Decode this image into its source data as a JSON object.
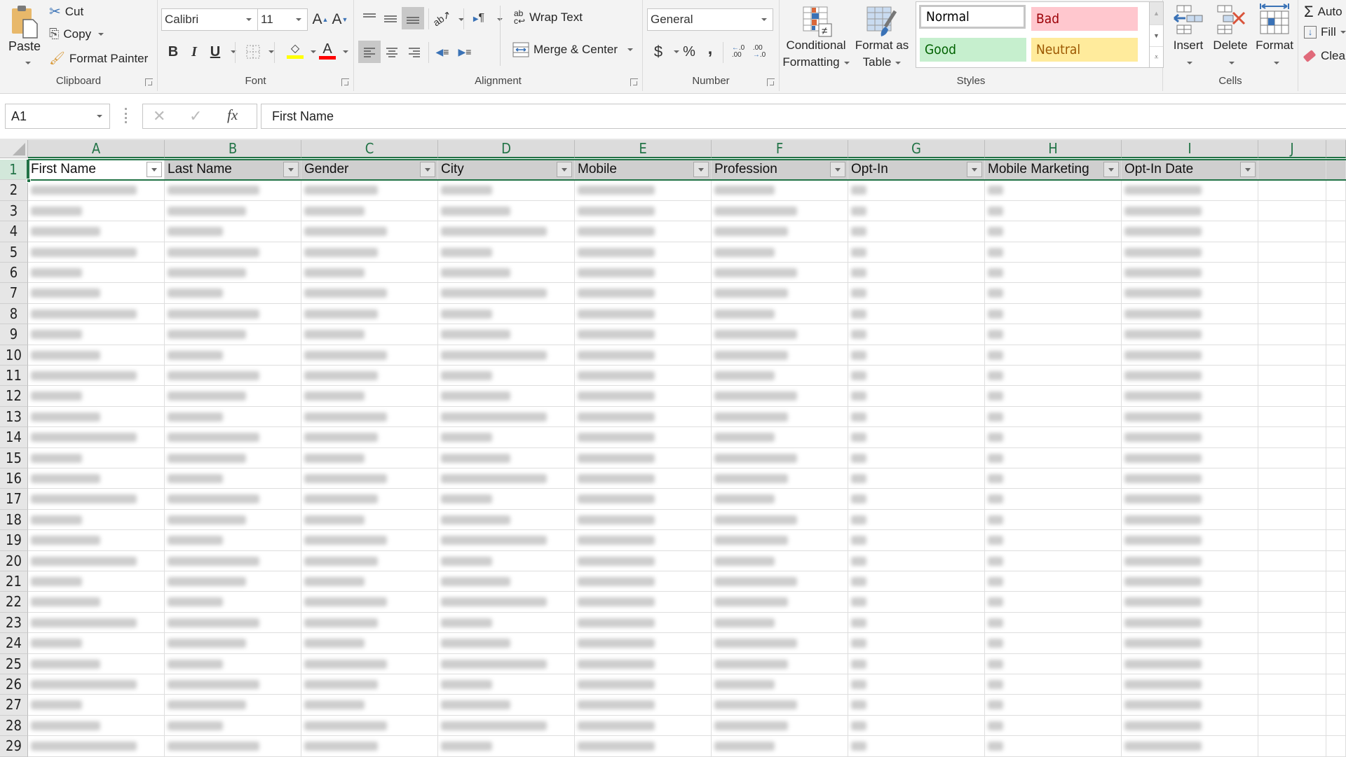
{
  "ribbon": {
    "clipboard": {
      "label": "Clipboard",
      "paste": "Paste",
      "cut": "Cut",
      "copy": "Copy",
      "format_painter": "Format Painter"
    },
    "font": {
      "label": "Font",
      "font_name": "Calibri",
      "font_size": "11",
      "bold": "B",
      "italic": "I",
      "underline": "U",
      "fill_color": "#ffff00",
      "font_color": "#ff0000"
    },
    "alignment": {
      "label": "Alignment",
      "wrap_text": "Wrap Text",
      "merge_center": "Merge & Center"
    },
    "number": {
      "label": "Number",
      "format": "General",
      "currency": "$",
      "percent": "%",
      "comma": ","
    },
    "styles": {
      "label": "Styles",
      "conditional_formatting": [
        "Conditional",
        "Formatting"
      ],
      "format_as_table": [
        "Format as",
        "Table"
      ],
      "cell_styles": [
        {
          "name": "Normal",
          "bg": "#ffffff",
          "fg": "#000000"
        },
        {
          "name": "Bad",
          "bg": "#ffc7ce",
          "fg": "#9c0006"
        },
        {
          "name": "Good",
          "bg": "#c6efce",
          "fg": "#006100"
        },
        {
          "name": "Neutral",
          "bg": "#ffeb9c",
          "fg": "#9c5700"
        }
      ]
    },
    "cells": {
      "label": "Cells",
      "insert": "Insert",
      "delete": "Delete",
      "format": "Format"
    },
    "editing": {
      "autosum": "Auto",
      "fill": "Fill",
      "clear": "Clea"
    }
  },
  "formula_bar": {
    "name_box": "A1",
    "fx": "fx",
    "content": "First Name"
  },
  "sheet": {
    "accent": "#217346",
    "columns": [
      "A",
      "B",
      "C",
      "D",
      "E",
      "F",
      "G",
      "H",
      "I",
      "J"
    ],
    "headers": [
      "First Name",
      "Last Name",
      "Gender",
      "City",
      "Mobile",
      "Profession",
      "Opt-In",
      "Mobile Marketing",
      "Opt-In Date",
      ""
    ],
    "row_numbers": [
      "1",
      "2",
      "3",
      "4",
      "5",
      "6",
      "7",
      "8",
      "9",
      "10",
      "11",
      "12",
      "13",
      "14",
      "15",
      "16",
      "17",
      "18",
      "19",
      "20",
      "21",
      "22",
      "23",
      "24",
      "25",
      "26",
      "27",
      "28",
      "29"
    ],
    "active_cell": "A1",
    "data_note": "Data rows 2-29 are blurred/redacted in the screenshot"
  }
}
